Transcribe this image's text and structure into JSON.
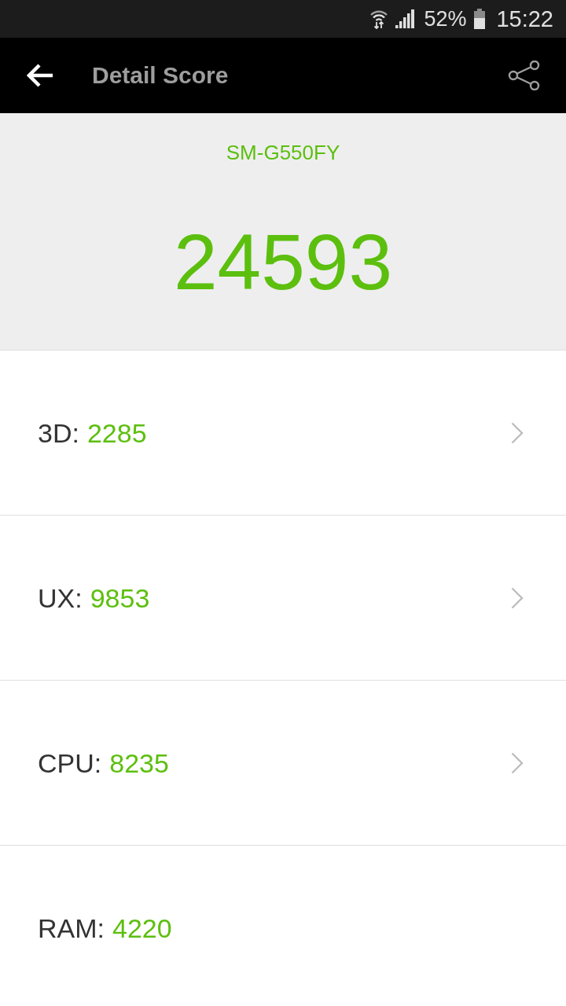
{
  "status_bar": {
    "battery": "52%",
    "time": "15:22"
  },
  "toolbar": {
    "title": "Detail Score"
  },
  "summary": {
    "device": "SM-G550FY",
    "total_score": "24593"
  },
  "categories": [
    {
      "label": "3D:",
      "score": "2285",
      "has_detail": true
    },
    {
      "label": "UX:",
      "score": "9853",
      "has_detail": true
    },
    {
      "label": "CPU:",
      "score": "8235",
      "has_detail": true
    },
    {
      "label": "RAM:",
      "score": "4220",
      "has_detail": false
    }
  ]
}
